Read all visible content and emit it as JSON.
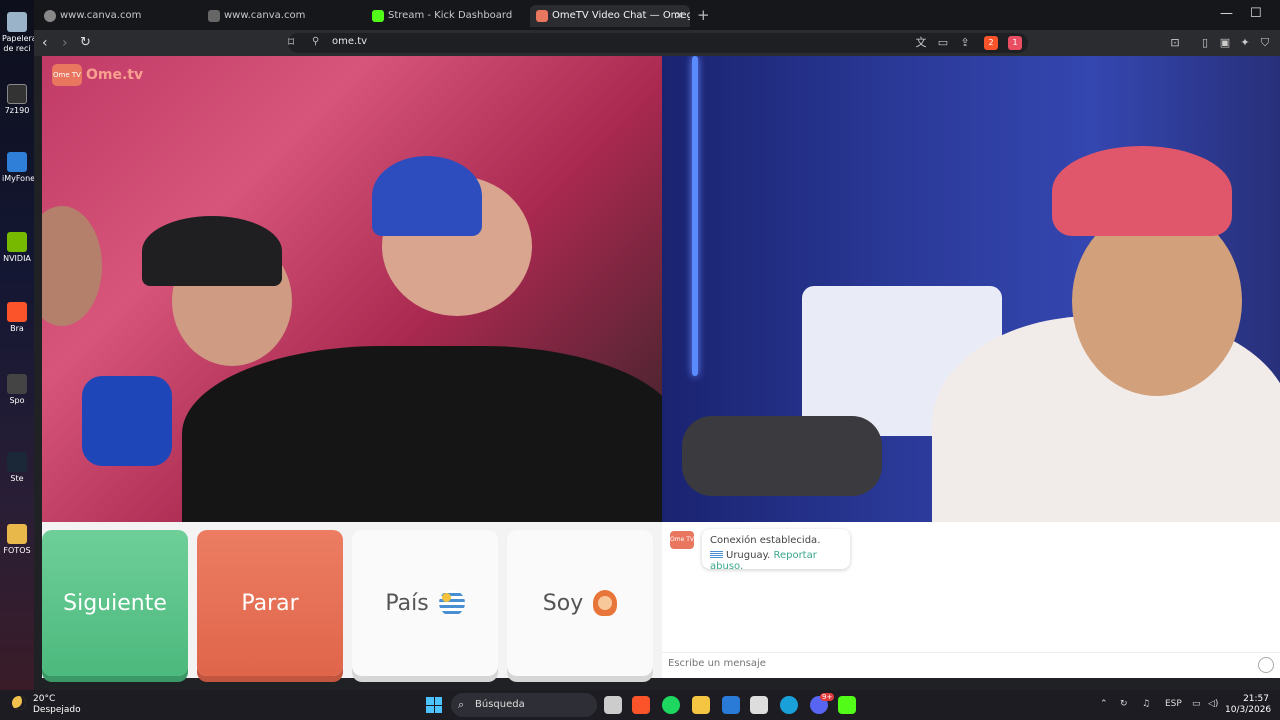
{
  "desktop": {
    "icons": [
      "Papelera de reci",
      "7z190",
      "iMyFone",
      "NVIDIA",
      "Bra",
      "Spo",
      "Ste",
      "FOTOS"
    ]
  },
  "tabs": [
    {
      "label": "www.canva.com"
    },
    {
      "label": "www.canva.com"
    },
    {
      "label": "Stream - Kick Dashboard"
    },
    {
      "label": "OmeTV Video Chat — Omeg"
    }
  ],
  "toolbar": {
    "url": "ome.tv",
    "brave_badge": "2",
    "rewards_badge": "1"
  },
  "page": {
    "logo": {
      "brand": "Ome.tv",
      "mark": "Ome TV"
    },
    "buttons": {
      "next": "Siguiente",
      "stop": "Parar",
      "country": "País",
      "gender": "Soy"
    },
    "chat": {
      "status": "Conexión establecida.",
      "country": "Uruguay.",
      "report": "Reportar abuso.",
      "placeholder": "Escribe un mensaje"
    }
  },
  "taskbar": {
    "weather_temp": "20°C",
    "weather_desc": "Despejado",
    "search_label": "Búsqueda",
    "lang": "ESP",
    "time": "21:57",
    "date": "10/3/2026",
    "discord_badge": "9+"
  }
}
